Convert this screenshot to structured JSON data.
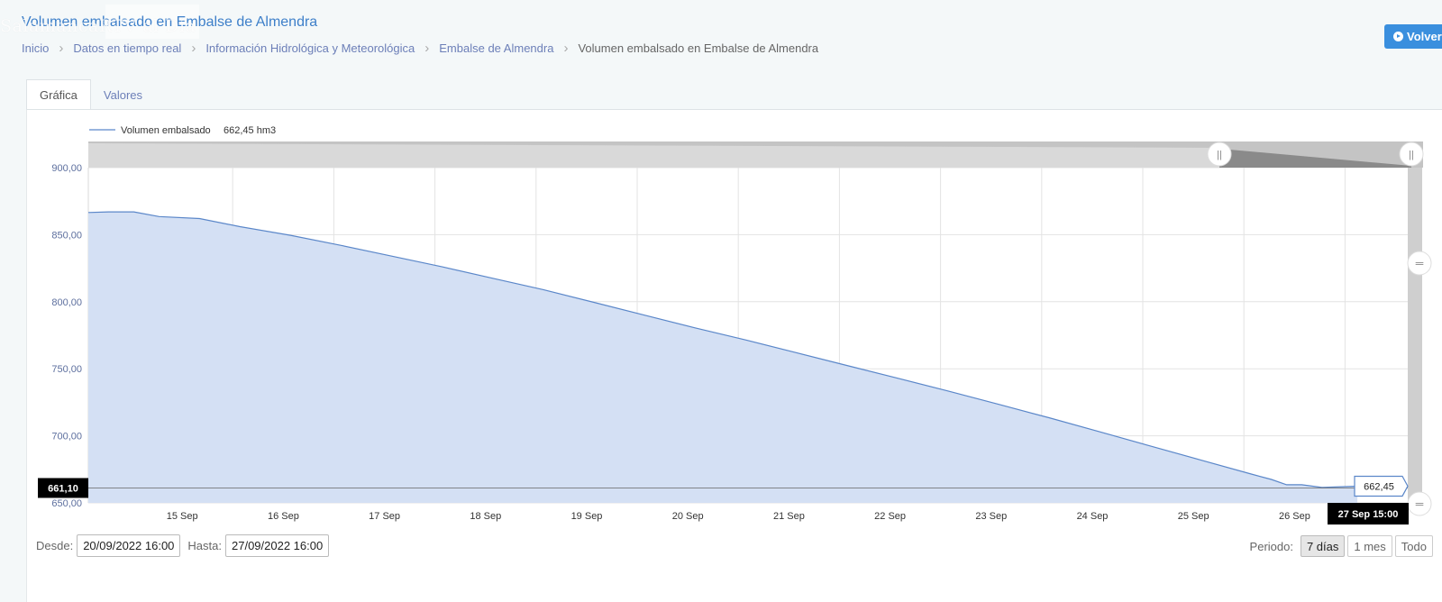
{
  "header": {
    "title": "Volumen embalsado en Embalse de Almendra",
    "watermark": "SalamancaRTV al Día",
    "back_button": "Volver"
  },
  "breadcrumb": [
    "Inicio",
    "Datos en tiempo real",
    "Información Hidrológica y Meteorológica",
    "Embalse de Almendra",
    "Volumen embalsado en Embalse de Almendra"
  ],
  "tabs": [
    {
      "label": "Gráfica",
      "active": true
    },
    {
      "label": "Valores",
      "active": false
    }
  ],
  "chart_data": {
    "type": "area",
    "legend": {
      "label": "Volumen embalsado",
      "value": "662,45 hm3",
      "placement": "top-left"
    },
    "ylim": [
      650,
      900
    ],
    "yticks": [
      "650,00",
      "700,00",
      "750,00",
      "800,00",
      "850,00",
      "900,00"
    ],
    "xticks": [
      "15 Sep",
      "16 Sep",
      "17 Sep",
      "18 Sep",
      "19 Sep",
      "20 Sep",
      "21 Sep",
      "22 Sep",
      "23 Sep",
      "24 Sep",
      "25 Sep",
      "26 Sep"
    ],
    "x_start_date": "2022-09-14T00:00",
    "x_unit": "days",
    "series": [
      {
        "x": [
          0,
          0.2,
          0.45,
          0.7,
          1.1,
          1.5,
          2,
          2.5,
          3,
          3.5,
          4,
          4.5,
          5,
          5.5,
          6,
          6.5,
          7,
          7.5,
          8,
          8.5,
          9,
          9.5,
          10,
          10.5,
          11,
          11.5,
          11.7,
          11.85,
          12,
          12.2,
          12.55
        ],
        "y": [
          866.5,
          867,
          867,
          863.5,
          862,
          856,
          849.5,
          842,
          834,
          826,
          817.5,
          809,
          799.5,
          790,
          780.5,
          771.5,
          762,
          752.5,
          743,
          733.5,
          723.5,
          713.5,
          703,
          692.5,
          682,
          671.5,
          667.5,
          663.5,
          663.5,
          661.5,
          662.45
        ]
      }
    ],
    "crosshair": {
      "y_label": "661,10",
      "y_value": 661.1,
      "x_label": "27 Sep 15:00",
      "value_label": "662,45"
    },
    "navigator": true,
    "grid": true
  },
  "controls": {
    "desde_label": "Desde:",
    "desde_value": "20/09/2022 16:00",
    "hasta_label": "Hasta:",
    "hasta_value": "27/09/2022 16:00",
    "periodo_label": "Periodo:",
    "periodo_options": [
      "7 días",
      "1 mes",
      "Todo"
    ],
    "periodo_selected": "7 días"
  },
  "colors": {
    "series_line": "#5b87c9",
    "series_fill": "#d4e0f4",
    "link": "#3d7fc9",
    "button": "#3a8fde"
  }
}
